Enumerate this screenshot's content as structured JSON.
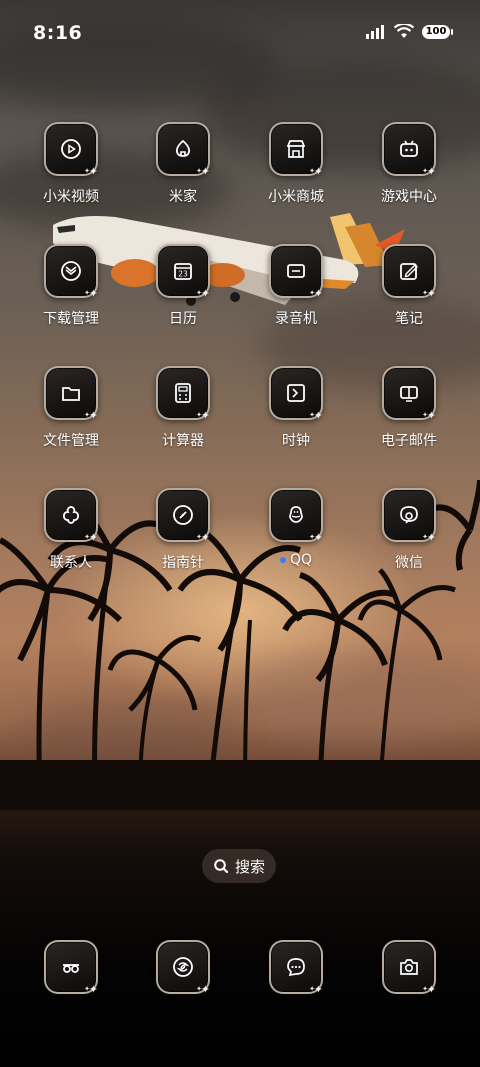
{
  "status_bar": {
    "time": "8:16",
    "battery": "100"
  },
  "apps": [
    {
      "label": "小米视频",
      "icon": "video-play-icon"
    },
    {
      "label": "米家",
      "icon": "home-icon"
    },
    {
      "label": "小米商城",
      "icon": "store-icon"
    },
    {
      "label": "游戏中心",
      "icon": "game-icon"
    },
    {
      "label": "下载管理",
      "icon": "download-icon"
    },
    {
      "label": "日历",
      "icon": "calendar-icon",
      "day": "23"
    },
    {
      "label": "录音机",
      "icon": "recorder-icon"
    },
    {
      "label": "笔记",
      "icon": "notes-icon"
    },
    {
      "label": "文件管理",
      "icon": "folder-icon"
    },
    {
      "label": "计算器",
      "icon": "calculator-icon"
    },
    {
      "label": "时钟",
      "icon": "clock-icon"
    },
    {
      "label": "电子邮件",
      "icon": "email-icon"
    },
    {
      "label": "联系人",
      "icon": "contacts-icon"
    },
    {
      "label": "指南针",
      "icon": "compass-icon"
    },
    {
      "label": "QQ",
      "icon": "qq-icon"
    },
    {
      "label": "微信",
      "icon": "wechat-icon"
    }
  ],
  "search": {
    "label": "搜索"
  },
  "dock": [
    {
      "icon": "phone-icon"
    },
    {
      "icon": "browser-icon"
    },
    {
      "icon": "messages-icon"
    },
    {
      "icon": "camera-icon"
    }
  ],
  "colors": {
    "notification_dot": "#3b7cff"
  }
}
